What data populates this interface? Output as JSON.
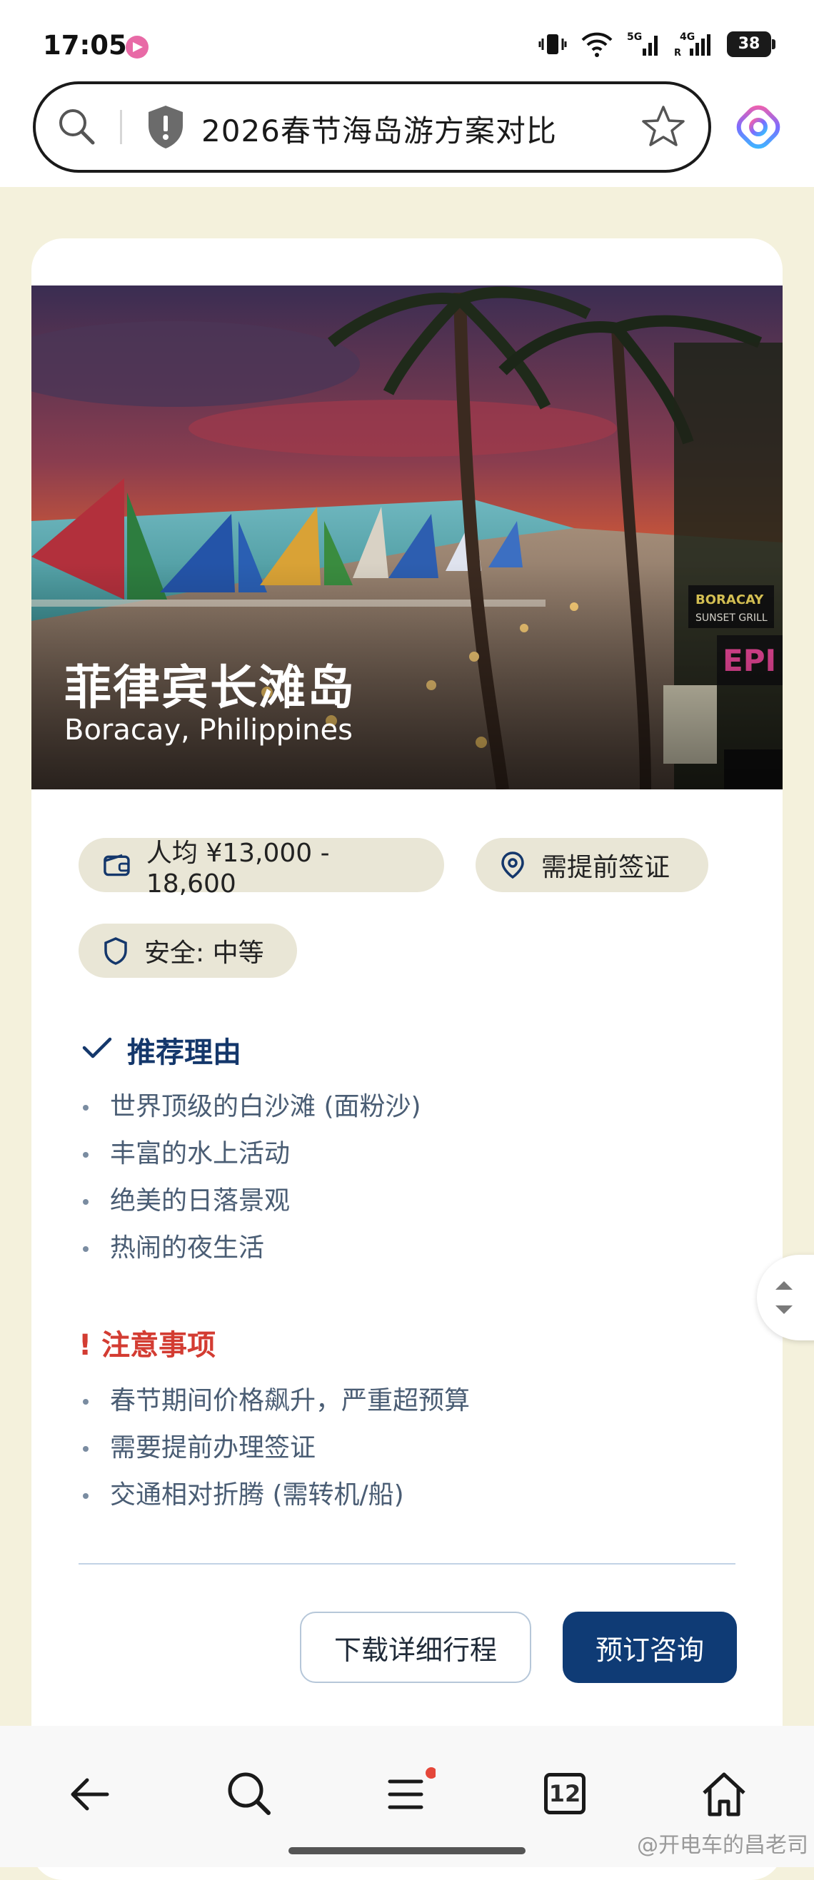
{
  "status_bar": {
    "time": "17:05",
    "network_5g": "5G",
    "network_4g": "4G",
    "battery": "38"
  },
  "browser": {
    "search_text": "2026春节海岛游方案对比"
  },
  "destination": {
    "title": "菲律宾长滩岛",
    "subtitle": "Boracay, Philippines",
    "tags": {
      "price": "人均 ¥13,000 - 18,600",
      "visa": "需提前签证",
      "safety": "安全: 中等"
    },
    "reasons": {
      "heading": "推荐理由",
      "items": [
        "世界顶级的白沙滩 (面粉沙)",
        "丰富的水上活动",
        "绝美的日落景观",
        "热闹的夜生活"
      ]
    },
    "notes": {
      "heading": "! 注意事项",
      "items": [
        "春节期间价格飙升，严重超预算",
        "需要提前办理签证",
        "交通相对折腾 (需转机/船)"
      ]
    },
    "buttons": {
      "download": "下载详细行程",
      "book": "预订咨询"
    }
  },
  "bottom_nav": {
    "tabs_count": "12"
  },
  "watermark": "@开电车的昌老司",
  "colors": {
    "page_bg": "#f4f1dc",
    "primary": "#0f3b75",
    "warning": "#d33c32",
    "chip_bg": "#e9e6d6"
  }
}
